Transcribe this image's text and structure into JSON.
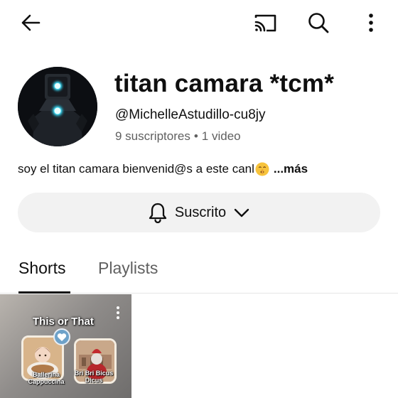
{
  "topbar": {
    "icons": [
      "back-arrow-icon",
      "cast-icon",
      "search-icon",
      "more-vert-icon"
    ]
  },
  "channel": {
    "name": "titan camara *tcm*",
    "handle": "@MichelleAstudillo-cu8jy",
    "subscribers": "9 suscriptores",
    "separator": "•",
    "videos": "1 video",
    "description": "soy el titan camara bienvenid@s a este canl",
    "description_emoji": "shushing-face-emoji",
    "more_label": "...más"
  },
  "subscribe_button": {
    "label": "Suscrito",
    "icons": [
      "bell-icon",
      "chevron-down-icon"
    ]
  },
  "tabs": [
    {
      "label": "Shorts",
      "selected": true
    },
    {
      "label": "Playlists",
      "selected": false
    }
  ],
  "shorts": [
    {
      "title": "This or That",
      "left_option": "Ballerina Cappuccina",
      "right_option": "Bri Bri Bicus Dicus"
    }
  ],
  "colors": {
    "text_primary": "#0f0f0f",
    "text_secondary": "#606060",
    "pill_background": "#f2f2f2",
    "divider": "#e5e5e5"
  }
}
